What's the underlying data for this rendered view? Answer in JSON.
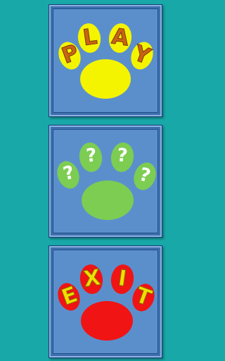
{
  "background_color": "#18a8a8",
  "tiles": [
    {
      "name": "play",
      "letters": [
        "P",
        "L",
        "A",
        "Y"
      ],
      "paw_color": "#f4f400",
      "letter_color": "#c86414",
      "letter_stroke": "#7a3a06"
    },
    {
      "name": "mystery",
      "letters": [
        "?",
        "?",
        "?",
        "?"
      ],
      "paw_color": "#7ccd52"
    },
    {
      "name": "exit",
      "letters": [
        "E",
        "X",
        "I",
        "T"
      ],
      "paw_color": "#f01414",
      "letter_color": "#f0e000",
      "letter_stroke": "#8a6e00"
    }
  ]
}
